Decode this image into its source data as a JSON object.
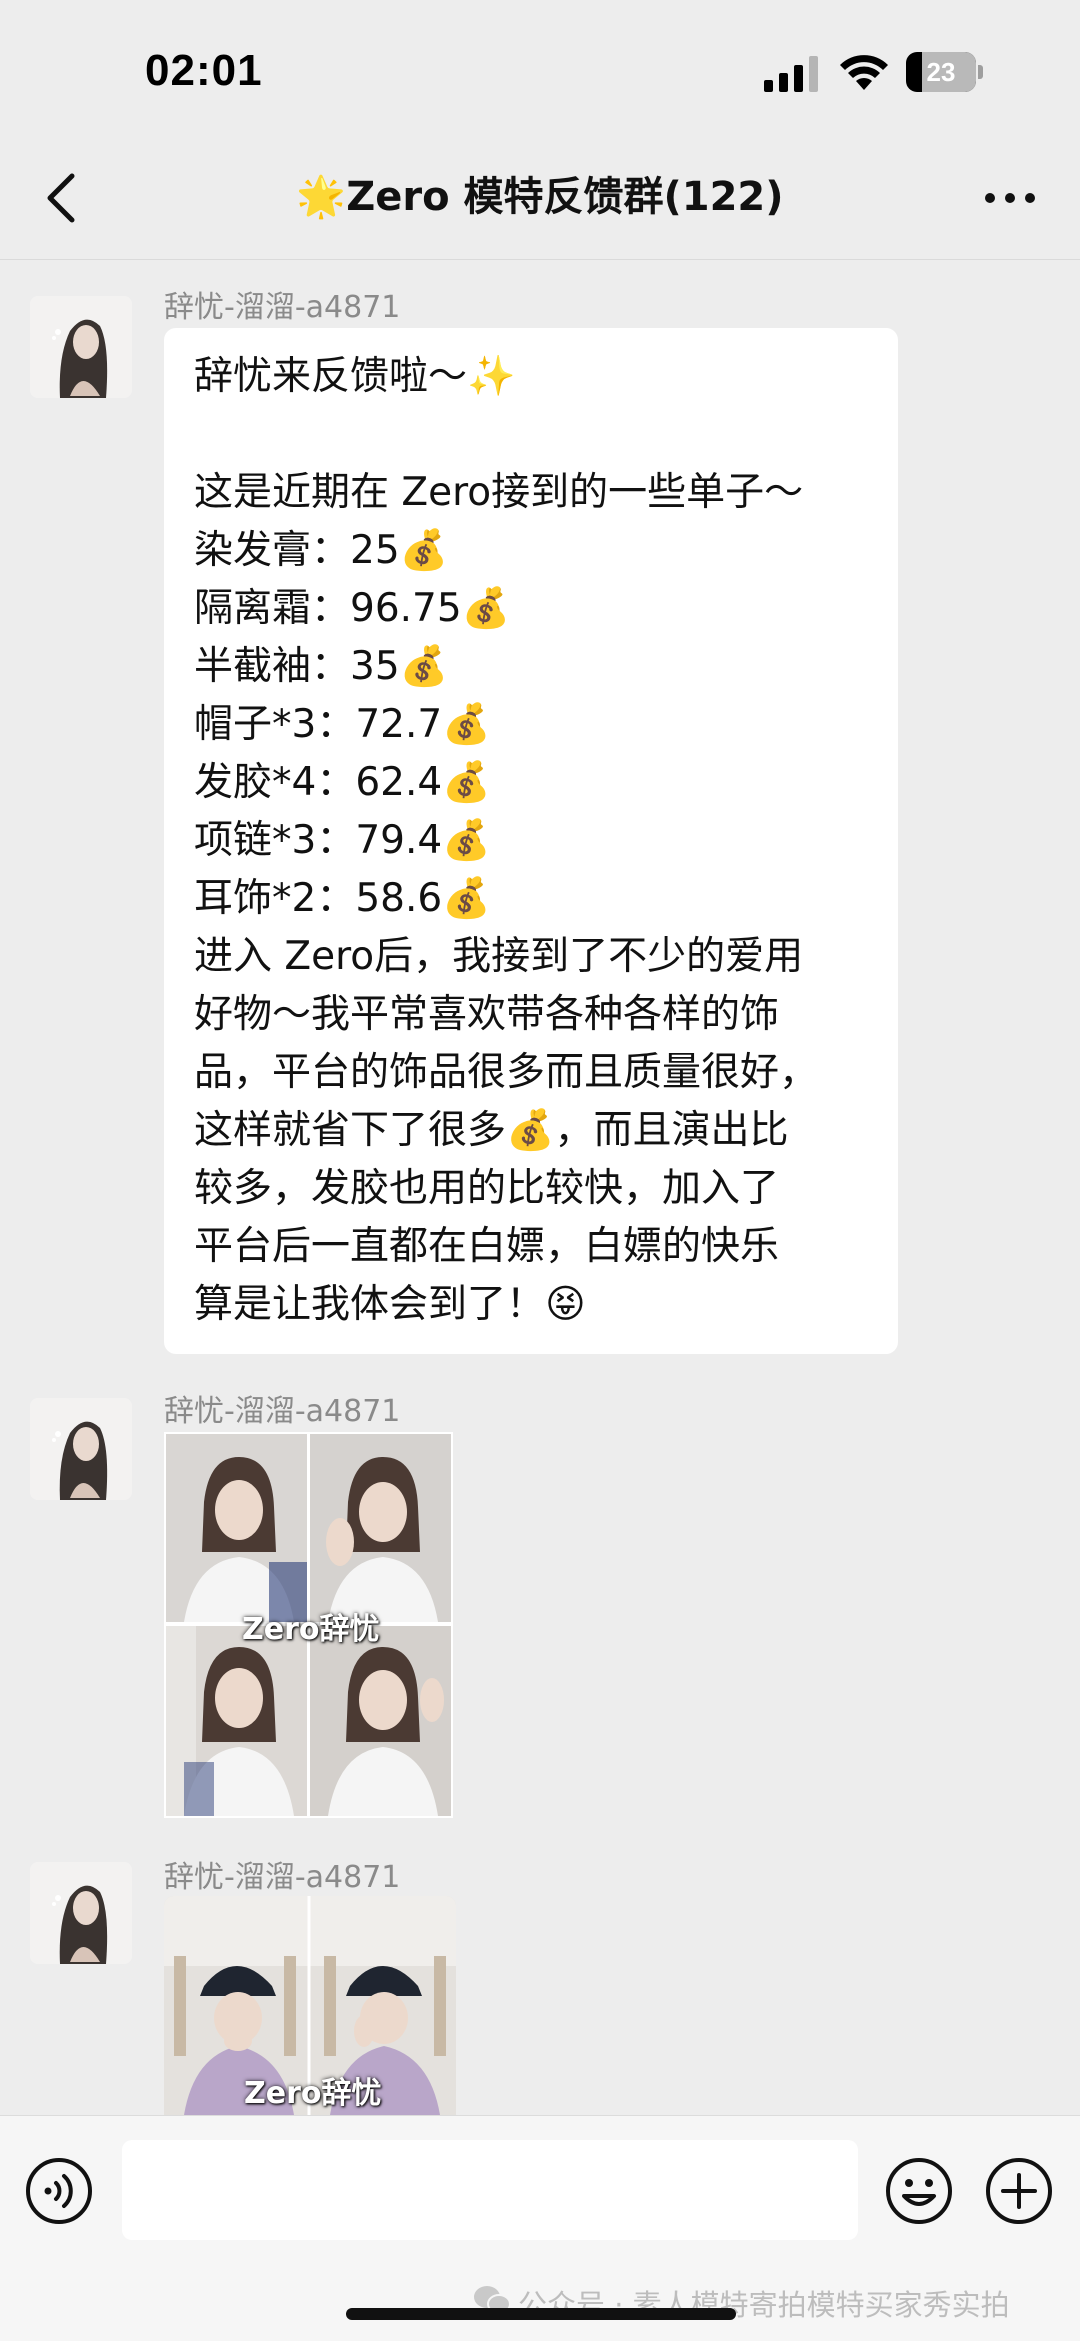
{
  "status_bar": {
    "time": "02:01",
    "battery": "23",
    "battery_level": 0.23
  },
  "nav": {
    "title": "🌟Zero 模特反馈群(122)"
  },
  "messages": [
    {
      "sender": "辞忧-溜溜-a4871",
      "type": "text",
      "lines": [
        "辞忧来反馈啦～✨",
        "",
        "这是近期在 Zero接到的一些单子～",
        "染发膏：25💰",
        "隔离霜：96.75💰",
        "半截袖：35💰",
        "帽子*3：72.7💰",
        "发胶*4：62.4💰",
        "项链*3：79.4💰",
        "耳饰*2：58.6💰",
        "进入 Zero后，我接到了不少的爱用",
        "好物～我平常喜欢带各种各样的饰",
        "品，平台的饰品很多而且质量很好，",
        "这样就省下了很多💰，而且演出比",
        "较多，发胶也用的比较快，加入了",
        "平台后一直都在白嫖，白嫖的快乐",
        "算是让我体会到了！😝"
      ]
    },
    {
      "sender": "辞忧-溜溜-a4871",
      "type": "image",
      "watermark": "Zero辞忧"
    },
    {
      "sender": "辞忧-溜溜-a4871",
      "type": "image",
      "watermark": "Zero辞忧"
    }
  ],
  "input_bar": {
    "placeholder": ""
  },
  "footer": {
    "watermark": "公众号 · 素人模特寄拍模特买家秀实拍"
  },
  "icons": [
    "back-icon",
    "more-icon",
    "voice-icon",
    "emoji-icon",
    "plus-icon",
    "signal-icon",
    "wifi-icon",
    "battery-icon"
  ]
}
